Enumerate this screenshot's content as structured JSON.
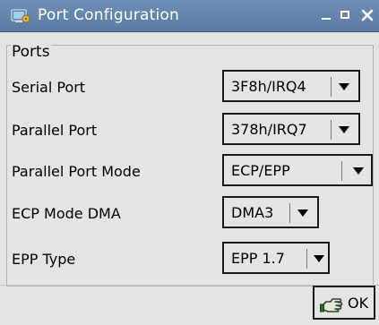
{
  "window": {
    "title": "Port Configuration",
    "icon": "monitor-settings-icon",
    "controls": {
      "minimize": "minimize-icon",
      "maximize": "maximize-icon",
      "close": "close-icon"
    }
  },
  "group": {
    "legend": "Ports"
  },
  "fields": [
    {
      "label": "Serial Port",
      "value": "3F8h/IRQ4"
    },
    {
      "label": "Parallel Port",
      "value": "378h/IRQ7"
    },
    {
      "label": "Parallel Port Mode",
      "value": "ECP/EPP"
    },
    {
      "label": "ECP Mode DMA",
      "value": "DMA3"
    },
    {
      "label": "EPP Type",
      "value": "EPP 1.7"
    }
  ],
  "actions": {
    "ok_label": "OK",
    "ok_icon": "hand-pointer-icon"
  },
  "colors": {
    "titlebar": "#5f80aa",
    "background": "#e4e4e4",
    "border": "#1a1a1a"
  }
}
